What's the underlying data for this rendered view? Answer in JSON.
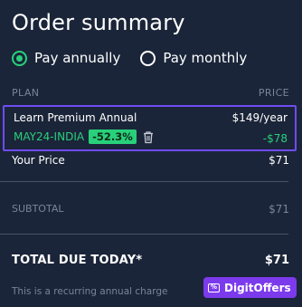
{
  "title": "Order summary",
  "billing": {
    "options": [
      {
        "label": "Pay annually",
        "selected": true
      },
      {
        "label": "Pay monthly",
        "selected": false
      }
    ]
  },
  "columns": {
    "plan": "PLAN",
    "price": "PRICE"
  },
  "item": {
    "name": "Learn Premium Annual",
    "price": "$149/year",
    "coupon_code": "MAY24-INDIA",
    "discount_percent": "-52.3%",
    "discount_amount": "-$78"
  },
  "your_price": {
    "label": "Your Price",
    "value": "$71"
  },
  "subtotal": {
    "label": "SUBTOTAL",
    "value": "$71"
  },
  "total": {
    "label": "TOTAL DUE TODAY*",
    "value": "$71"
  },
  "footnote": "This is a recurring annual charge",
  "brand": {
    "name": "DigitOffers",
    "icon_glyph": "%"
  },
  "colors": {
    "background": "#1b2539",
    "accent_green": "#28d07a",
    "highlight_purple": "#6f4cf5",
    "brand_purple": "#7c3aed"
  }
}
